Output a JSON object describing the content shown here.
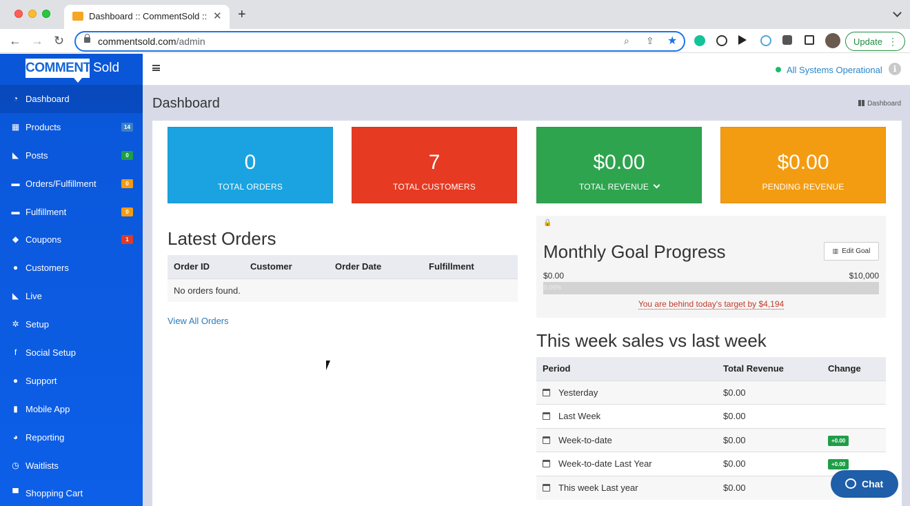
{
  "browser": {
    "tab_title": "Dashboard :: CommentSold ::",
    "tab_close": "✕",
    "new_tab": "+",
    "url_host": "commentsold.com",
    "url_path": "/admin",
    "update_label": "Update",
    "update_menu": "⋮",
    "nav_back": "←",
    "nav_forward": "→",
    "nav_reload": "↻"
  },
  "brand": {
    "comment": "COMMENT",
    "sold": "Sold"
  },
  "sidebar": {
    "items": [
      {
        "label": "Dashboard",
        "icon": "dashboard-icon",
        "glyph": "◔",
        "badge": "",
        "badge_color": ""
      },
      {
        "label": "Products",
        "icon": "grid-icon",
        "glyph": "▦",
        "badge": "14",
        "badge_color": "#3b80c6"
      },
      {
        "label": "Posts",
        "icon": "rss-icon",
        "glyph": "◣",
        "badge": "0",
        "badge_color": "#1e9e47"
      },
      {
        "label": "Orders/Fulfillment",
        "icon": "truck-icon",
        "glyph": "▬",
        "badge": "0",
        "badge_color": "#f39c12"
      },
      {
        "label": "Fulfillment",
        "icon": "truck-icon",
        "glyph": "▬",
        "badge": "0",
        "badge_color": "#f39c12"
      },
      {
        "label": "Coupons",
        "icon": "tag-icon",
        "glyph": "◆",
        "badge": "1",
        "badge_color": "#dd3b2a"
      },
      {
        "label": "Customers",
        "icon": "user-icon",
        "glyph": "●",
        "badge": "",
        "badge_color": ""
      },
      {
        "label": "Live",
        "icon": "rss-icon",
        "glyph": "◣",
        "badge": "",
        "badge_color": ""
      },
      {
        "label": "Setup",
        "icon": "cogs-icon",
        "glyph": "✲",
        "badge": "",
        "badge_color": ""
      },
      {
        "label": "Social Setup",
        "icon": "facebook-icon",
        "glyph": "f",
        "badge": "",
        "badge_color": ""
      },
      {
        "label": "Support",
        "icon": "comments-icon",
        "glyph": "●",
        "badge": "",
        "badge_color": ""
      },
      {
        "label": "Mobile App",
        "icon": "mobile-icon",
        "glyph": "▮",
        "badge": "",
        "badge_color": ""
      },
      {
        "label": "Reporting",
        "icon": "pie-chart-icon",
        "glyph": "◕",
        "badge": "",
        "badge_color": ""
      },
      {
        "label": "Waitlists",
        "icon": "clock-icon",
        "glyph": "◷",
        "badge": "",
        "badge_color": ""
      },
      {
        "label": "Shopping Cart",
        "icon": "cart-icon",
        "glyph": "▀",
        "badge": "",
        "badge_color": ""
      }
    ]
  },
  "header": {
    "status_text": "All Systems Operational",
    "status_color": "#1abc6c",
    "info_glyph": "i"
  },
  "page": {
    "title": "Dashboard",
    "breadcrumb": "Dashboard"
  },
  "stats": [
    {
      "value": "0",
      "label": "TOTAL ORDERS",
      "color": "#1aa3e0"
    },
    {
      "value": "7",
      "label": "TOTAL CUSTOMERS",
      "color": "#e63a22"
    },
    {
      "value": "$0.00",
      "label": "TOTAL REVENUE",
      "color": "#2ea44f"
    },
    {
      "value": "$0.00",
      "label": "PENDING REVENUE",
      "color": "#f39c12"
    }
  ],
  "latest_orders": {
    "title": "Latest Orders",
    "columns": [
      "Order ID",
      "Customer",
      "Order Date",
      "Fulfillment"
    ],
    "empty_text": "No orders found.",
    "view_all": "View All Orders"
  },
  "goal": {
    "lock_glyph": "🔒",
    "title": "Monthly Goal Progress",
    "edit_label": "Edit Goal",
    "min_label": "$0.00",
    "max_label": "$10,000",
    "progress_percent": 0,
    "progress_text": "0.00%",
    "behind_text": "You are behind today's target by $4,194"
  },
  "weekly": {
    "title": "This week sales vs last week",
    "columns": [
      "Period",
      "Total Revenue",
      "Change"
    ],
    "rows": [
      {
        "period": "Yesterday",
        "revenue": "$0.00",
        "change": ""
      },
      {
        "period": "Last Week",
        "revenue": "$0.00",
        "change": ""
      },
      {
        "period": "Week-to-date",
        "revenue": "$0.00",
        "change": "+0.00"
      },
      {
        "period": "Week-to-date Last Year",
        "revenue": "$0.00",
        "change": "+0.00"
      },
      {
        "period": "This week Last year",
        "revenue": "$0.00",
        "change": ""
      }
    ]
  },
  "chat": {
    "label": "Chat"
  }
}
